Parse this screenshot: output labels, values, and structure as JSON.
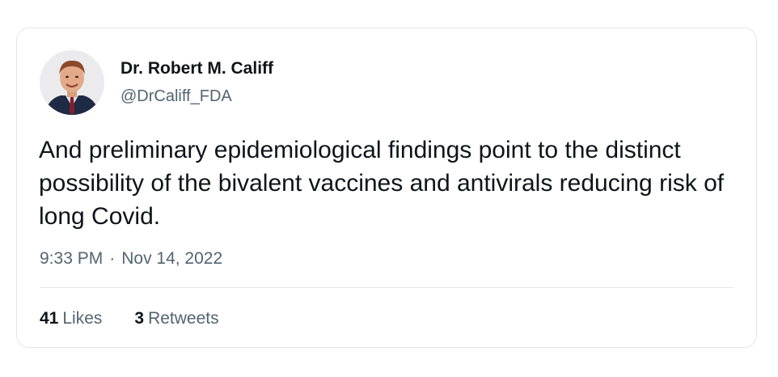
{
  "author": {
    "display_name": "Dr. Robert M. Califf",
    "handle": "@DrCaliff_FDA",
    "avatar_icon": "profile-photo"
  },
  "tweet": {
    "text": "And preliminary epidemiological findings point to the distinct possibility of the bivalent vaccines and antivirals reducing risk of long Covid."
  },
  "meta": {
    "time": "9:33 PM",
    "separator": "·",
    "date": "Nov 14, 2022"
  },
  "stats": {
    "likes_count": "41",
    "likes_label": "Likes",
    "retweets_count": "3",
    "retweets_label": "Retweets"
  },
  "colors": {
    "text_primary": "#0f1419",
    "text_secondary": "#536471",
    "border": "#e3e6ea"
  }
}
